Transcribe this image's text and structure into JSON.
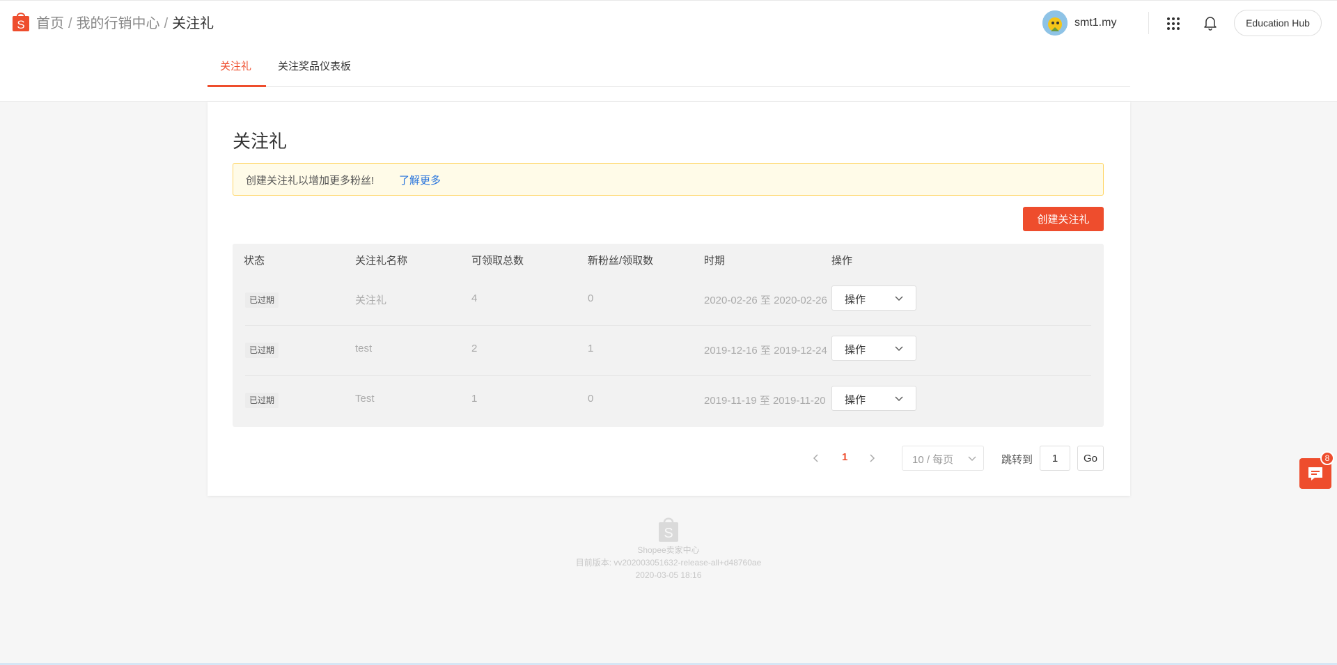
{
  "breadcrumb": {
    "home": "首页",
    "marketing": "我的行销中心",
    "current": "关注礼",
    "separator": "/"
  },
  "user": {
    "name": "smt1.my"
  },
  "header": {
    "education_hub": "Education Hub"
  },
  "tabs": [
    {
      "label": "关注礼",
      "active": true
    },
    {
      "label": "关注奖品仪表板",
      "active": false
    }
  ],
  "page": {
    "title": "关注礼",
    "notice_text": "创建关注礼以增加更多粉丝!",
    "notice_link": "了解更多",
    "create_button": "创建关注礼"
  },
  "table": {
    "columns": [
      "状态",
      "关注礼名称",
      "可领取总数",
      "新粉丝/领取数",
      "时期",
      "操作"
    ],
    "rows": [
      {
        "status": "已过期",
        "name": "关注礼",
        "total": "4",
        "fans": "0",
        "period": "2020-02-26 至 2020-02-26",
        "action": "操作"
      },
      {
        "status": "已过期",
        "name": "test",
        "total": "2",
        "fans": "1",
        "period": "2019-12-16 至 2019-12-24",
        "action": "操作"
      },
      {
        "status": "已过期",
        "name": "Test",
        "total": "1",
        "fans": "0",
        "period": "2019-11-19 至 2019-11-20",
        "action": "操作"
      }
    ]
  },
  "pagination": {
    "current_page": "1",
    "page_size": "10 / 每页",
    "jump_label": "跳转到",
    "jump_value": "1",
    "go": "Go"
  },
  "footer": {
    "name": "Shopee卖家中心",
    "version": "目前版本: vv202003051632-release-all+d48760ae",
    "date": "2020-03-05 18:16"
  },
  "chat": {
    "badge": "8"
  },
  "colors": {
    "brand": "#ee4d2d",
    "link": "#2673dd",
    "notice_bg": "#fffbe8",
    "notice_border": "#ffd666"
  }
}
